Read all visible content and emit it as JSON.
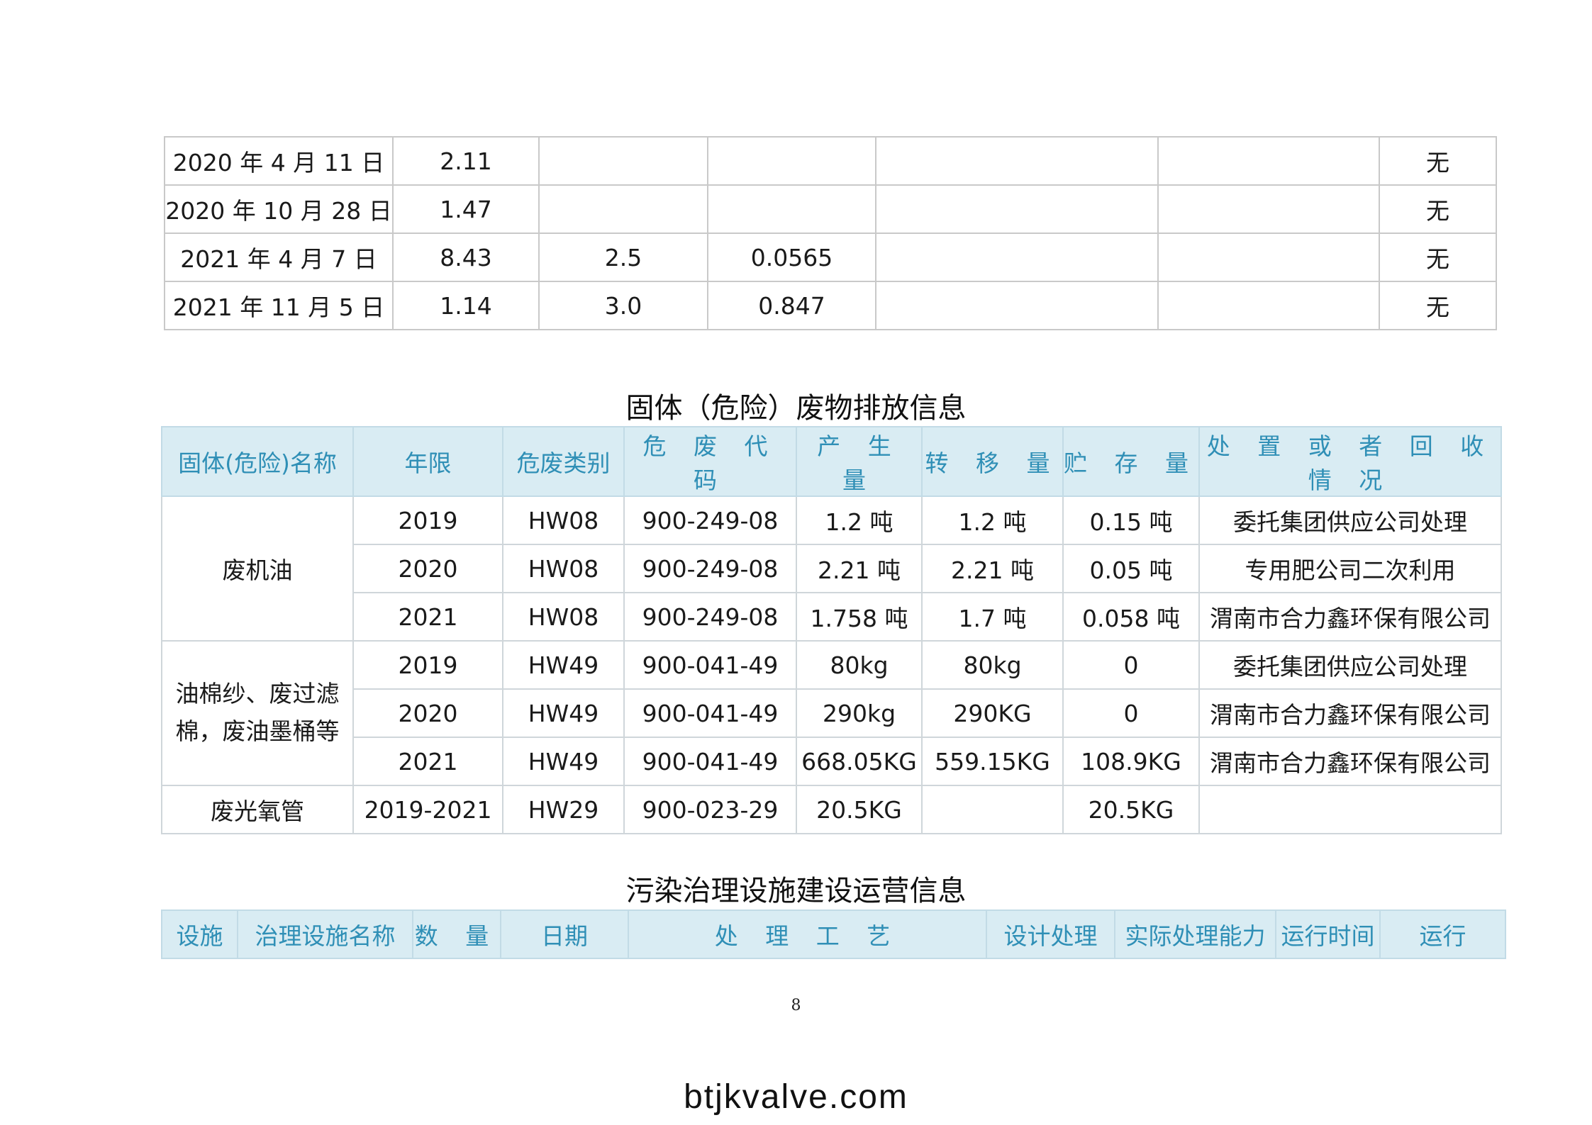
{
  "table1": {
    "rows": [
      [
        "2020 年 4 月 11 日",
        "2.11",
        "",
        "",
        "",
        "",
        "无"
      ],
      [
        "2020 年 10 月 28 日",
        "1.47",
        "",
        "",
        "",
        "",
        "无"
      ],
      [
        "2021 年 4 月 7 日",
        "8.43",
        "2.5",
        "0.0565",
        "",
        "",
        "无"
      ],
      [
        "2021 年 11 月 5 日",
        "1.14",
        "3.0",
        "0.847",
        "",
        "",
        "无"
      ]
    ]
  },
  "section2": {
    "title": "固体（危险）废物排放信息",
    "headers": [
      "固体(危险)名称",
      "年限",
      "危废类别",
      "危 废 代 码",
      "产 生 量",
      "转 移 量",
      "贮 存 量",
      "处 置 或 者 回 收 情 况"
    ],
    "groups": [
      {
        "name": "废机油",
        "rows": [
          [
            "2019",
            "HW08",
            "900-249-08",
            "1.2 吨",
            "1.2 吨",
            "0.15 吨",
            "委托集团供应公司处理"
          ],
          [
            "2020",
            "HW08",
            "900-249-08",
            "2.21 吨",
            "2.21 吨",
            "0.05 吨",
            "专用肥公司二次利用"
          ],
          [
            "2021",
            "HW08",
            "900-249-08",
            "1.758 吨",
            "1.7 吨",
            "0.058 吨",
            "渭南市合力鑫环保有限公司"
          ]
        ]
      },
      {
        "name_line1": "油棉纱、废过滤",
        "name_line2": "棉，废油墨桶等",
        "rows": [
          [
            "2019",
            "HW49",
            "900-041-49",
            "80kg",
            "80kg",
            "0",
            "委托集团供应公司处理"
          ],
          [
            "2020",
            "HW49",
            "900-041-49",
            "290kg",
            "290KG",
            "0",
            "渭南市合力鑫环保有限公司"
          ],
          [
            "2021",
            "HW49",
            "900-041-49",
            "668.05KG",
            "559.15KG",
            "108.9KG",
            "渭南市合力鑫环保有限公司"
          ]
        ]
      },
      {
        "name": "废光氧管",
        "rows": [
          [
            "2019-2021",
            "HW29",
            "900-023-29",
            "20.5KG",
            "",
            "20.5KG",
            ""
          ]
        ]
      }
    ]
  },
  "section3": {
    "title": "污染治理设施建设运营信息",
    "headers": [
      "设施",
      "治理设施名称",
      "数 量",
      "日期",
      "处 理 工 艺",
      "设计处理",
      "实际处理能力",
      "运行时间",
      "运行"
    ]
  },
  "page_number": "8",
  "watermark": "btjkvalve.com"
}
